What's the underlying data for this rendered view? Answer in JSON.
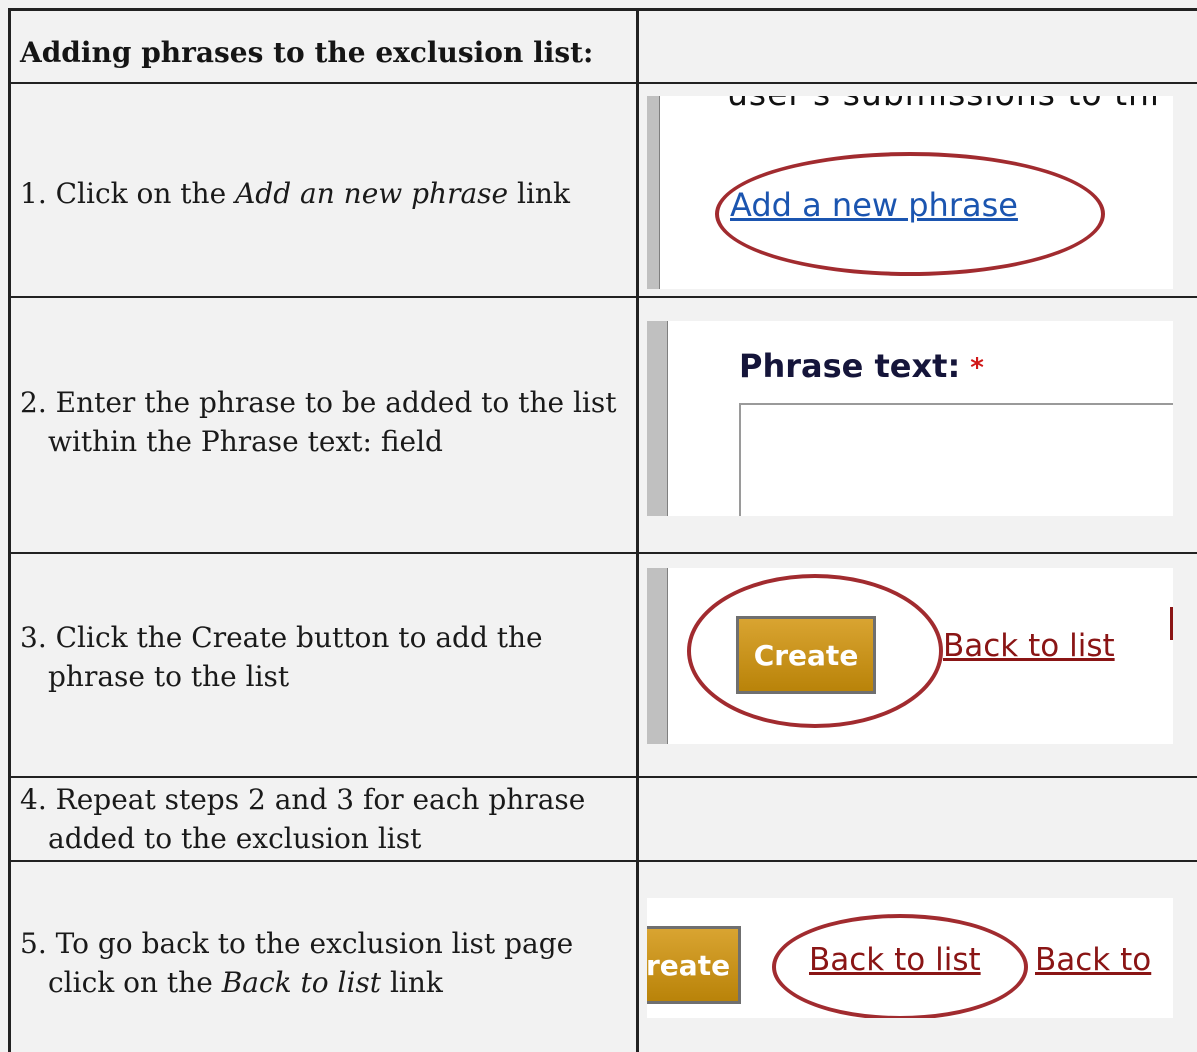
{
  "header": {
    "title": "Adding phrases to the exclusion list:"
  },
  "steps": [
    {
      "number": "1.",
      "lines": [
        {
          "before": "Click on the ",
          "em": "Add an new phrase",
          "after": " link"
        }
      ]
    },
    {
      "number": "2.",
      "lines": [
        {
          "text": "Enter the phrase to be added to the list"
        },
        {
          "text": "within the Phrase text: field"
        }
      ]
    },
    {
      "number": "3.",
      "lines": [
        {
          "text": "Click the Create button to add the"
        },
        {
          "text": "phrase to the list"
        }
      ]
    },
    {
      "number": "4.",
      "lines": [
        {
          "text": "Repeat steps 2 and 3 for each phrase"
        },
        {
          "text": "added to the exclusion list"
        }
      ]
    },
    {
      "number": "5.",
      "lines": [
        {
          "text": "To go back to the exclusion list page"
        },
        {
          "before": "click on the ",
          "em": "Back to list",
          "after": " link"
        }
      ]
    }
  ],
  "screenshots": {
    "shot1": {
      "cut_text": "user's submissions to thi",
      "link_label": "Add a new phrase"
    },
    "shot2": {
      "field_label": "Phrase text:",
      "required_marker": "*"
    },
    "shot3": {
      "button_label": "Create",
      "link_label": "Back to list"
    },
    "shot5": {
      "button_label": "reate",
      "link_label": "Back to list",
      "link2_label": "Back to"
    }
  },
  "colors": {
    "highlight_oval": "#a12b2f",
    "link_blue": "#1b55b0",
    "link_red": "#8a1515",
    "create_button": "#c8951c",
    "page_background": "#f2f2f2"
  }
}
